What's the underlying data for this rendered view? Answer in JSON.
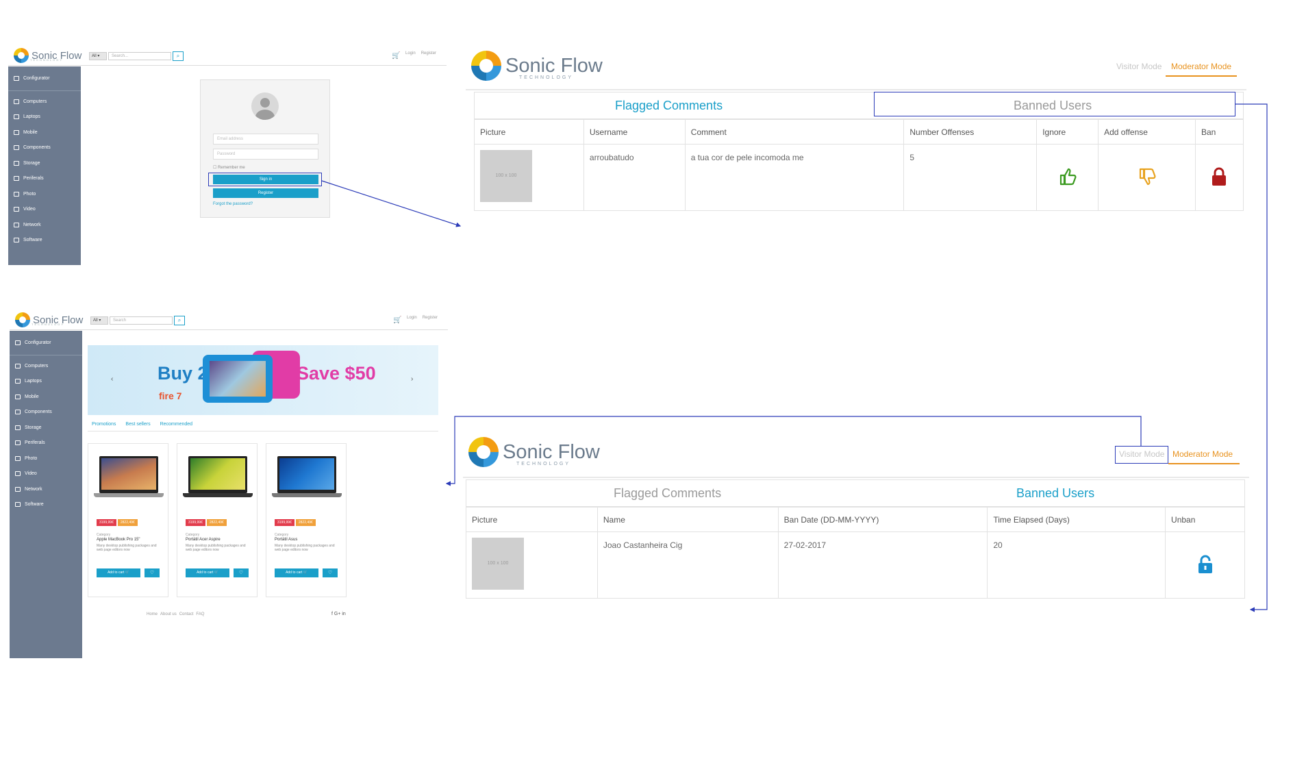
{
  "brand": {
    "name": "Sonic Flow",
    "tagline": "TECHNOLOGY"
  },
  "site_header": {
    "category_select": "All ▾",
    "search_placeholder": "Search...",
    "search_placeholder_2": "Search",
    "links": [
      "Login",
      "Register"
    ]
  },
  "sidebar": {
    "header": "Configurator",
    "items": [
      "Computers",
      "Laptops",
      "Mobile",
      "Components",
      "Storage",
      "Periferals",
      "Photo",
      "Video",
      "Network",
      "Software"
    ]
  },
  "login": {
    "email_placeholder": "Email address",
    "password_placeholder": "Password",
    "remember": "☐ Remember me",
    "sign_in": "Sign in",
    "register": "Register",
    "forgot": "Forgot the password?"
  },
  "home": {
    "banner": {
      "buy": "Buy 2",
      "save": "Save $50",
      "fire": "fire 7"
    },
    "tabs": [
      "Promotions",
      "Best sellers",
      "Recommended"
    ],
    "products": [
      {
        "old_price": "3199,99€",
        "new_price": "2822,49€",
        "category": "Category",
        "name": "Apple MacBook Pro 15\"",
        "desc": "Many desktop publishing packages and web page editors now",
        "add": "Add to cart 🛒",
        "wish": "♡"
      },
      {
        "old_price": "3199,99€",
        "new_price": "2822,49€",
        "category": "Category",
        "name": "Portátil Acer Aspire",
        "desc": "Many desktop publishing packages and web page editors now",
        "add": "Add to cart 🛒",
        "wish": "♡"
      },
      {
        "old_price": "3199,99€",
        "new_price": "2822,49€",
        "category": "Category",
        "name": "Portátil Asus",
        "desc": "Many desktop publishing packages and web page editors now",
        "add": "Add to cart 🛒",
        "wish": "♡"
      }
    ],
    "footer": [
      "Home",
      "About us",
      "Contact",
      "FAQ"
    ],
    "social": "f  G+  in"
  },
  "modes": {
    "visitor": "Visitor Mode",
    "moderator": "Moderator Mode"
  },
  "tabs": {
    "flagged": "Flagged Comments",
    "banned": "Banned Users"
  },
  "flagged_table": {
    "headers": [
      "Picture",
      "Username",
      "Comment",
      "Number Offenses",
      "Ignore",
      "Add offense",
      "Ban"
    ],
    "rows": [
      {
        "picture": "100 x 100",
        "username": "arroubatudo",
        "comment": "a tua cor de pele incomoda me",
        "offenses": "5"
      }
    ]
  },
  "banned_table": {
    "headers": [
      "Picture",
      "Name",
      "Ban Date (DD-MM-YYYY)",
      "Time Elapsed (Days)",
      "Unban"
    ],
    "rows": [
      {
        "picture": "100 x 100",
        "name": "Joao Castanheira Cig",
        "ban_date": "27-02-2017",
        "elapsed": "20"
      }
    ]
  },
  "colors": {
    "accent": "#1a9fc9",
    "moderator": "#e8921e",
    "sidebar": "#6c7a8f",
    "connector": "#2b3bb8",
    "ignore": "#3a9a1f",
    "offense": "#e8a21e",
    "ban": "#b01c1c",
    "unban": "#1a8fd0"
  }
}
